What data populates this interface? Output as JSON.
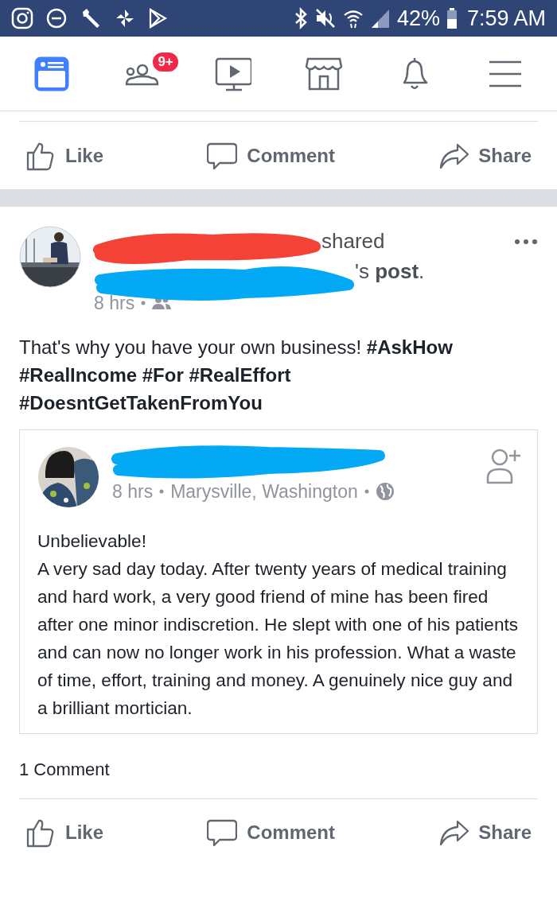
{
  "status_bar": {
    "battery": "42%",
    "time": "7:59 AM"
  },
  "nav_tabs": [
    {
      "kind": "feed",
      "selected": true
    },
    {
      "kind": "friends",
      "selected": false,
      "badge": "9+"
    },
    {
      "kind": "video",
      "selected": false
    },
    {
      "kind": "marketplace",
      "selected": false
    },
    {
      "kind": "notifications",
      "selected": false
    },
    {
      "kind": "menu",
      "selected": false
    }
  ],
  "top_actions": [
    "Like",
    "Comment",
    "Share"
  ],
  "post": {
    "header_first_line": "shared",
    "header_second_line": "'s **post**.",
    "time": "8 hrs",
    "text": "That's why you have your own business!  **#AskHow** **#RealIncome** **#For** **#RealEffort** **#DoesntGetTakenFromYou**",
    "shared_post": {
      "time": "8 hrs",
      "location": "Marysville, Washington",
      "lines": [
        "Unbelievable!",
        "A very sad day today. After twenty years of medical training and hard work, a very good friend of mine has been fired after one minor indiscretion. He slept with one of his patients and can now no longer work in his profession. What a waste of time, effort, training and money. A genuinely nice guy and a brilliant mortician."
      ]
    },
    "comment_count": "1 Comment",
    "actions": [
      "Like",
      "Comment",
      "Share"
    ]
  }
}
